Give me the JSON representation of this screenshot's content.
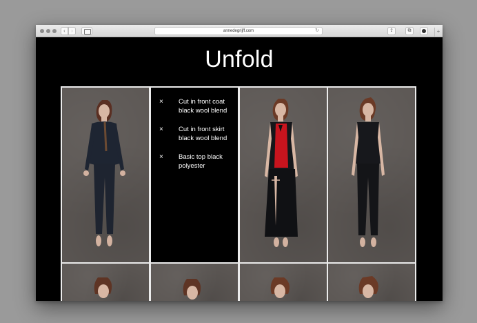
{
  "browser": {
    "url": "annedegrijff.com",
    "nav_back": "‹",
    "nav_forward": "›",
    "reload": "↻",
    "share": "⇪",
    "tabs": "⧉",
    "new_tab": "+"
  },
  "page": {
    "title": "Unfold",
    "items": [
      {
        "mark": "×",
        "text": "Cut in front coat black wool blend"
      },
      {
        "mark": "×",
        "text": "Cut in front skirt black wool blend"
      },
      {
        "mark": "×",
        "text": "Basic top black polyester"
      }
    ]
  },
  "colors": {
    "page_background": "#000000",
    "photo_background": "#5c5754",
    "frame": "#ececec",
    "accent_red": "#c8141e"
  }
}
